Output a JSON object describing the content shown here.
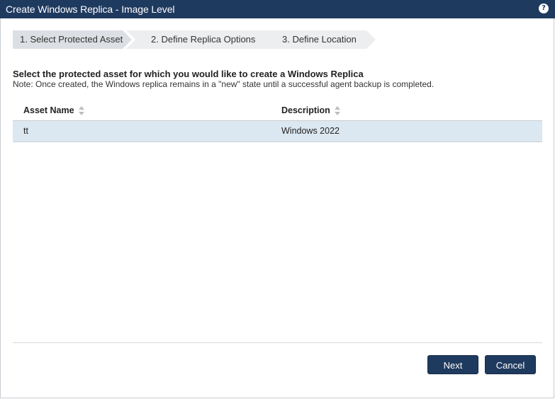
{
  "window": {
    "title": "Create Windows Replica - Image Level",
    "help_icon": "?"
  },
  "wizard": {
    "steps": [
      {
        "label": "1. Select Protected Asset",
        "active": true
      },
      {
        "label": "2. Define Replica Options",
        "active": false
      },
      {
        "label": "3. Define Location",
        "active": false
      }
    ]
  },
  "intro": {
    "heading": "Select the protected asset for which you would like to create a Windows Replica",
    "note": "Note: Once created, the Windows replica remains in a \"new\" state until a successful agent backup is completed."
  },
  "table": {
    "columns": [
      "Asset Name",
      "Description"
    ],
    "rows": [
      {
        "asset_name": "tt",
        "description": "Windows 2022",
        "selected": true
      }
    ]
  },
  "buttons": {
    "next": "Next",
    "cancel": "Cancel"
  },
  "colors": {
    "titlebar": "#1f3a5f",
    "selected_row": "#dce8f1",
    "active_step": "#dcdfe3",
    "inactive_step": "#eceef0"
  }
}
